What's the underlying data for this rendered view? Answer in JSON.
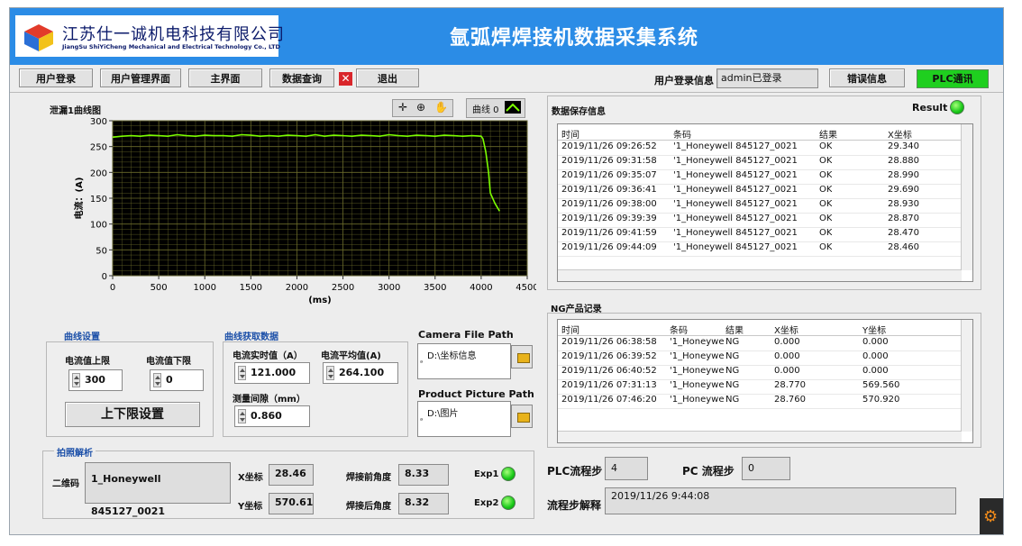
{
  "header": {
    "company_cn": "江苏仕一诚机电科技有限公司",
    "company_en": "JiangSu ShiYiCheng Mechanical and Electrical Technology Co., LTD",
    "system_title": "氩弧焊焊接机数据采集系统"
  },
  "toolbar": {
    "login": "用户登录",
    "user_mgmt": "用户管理界面",
    "main": "主界面",
    "query": "数据查询",
    "exit": "退出",
    "login_info_label": "用户登录信息",
    "login_status": "admin已登录",
    "error_info": "错误信息",
    "plc_comm": "PLC通讯"
  },
  "chart_panel": {
    "title": "泄漏1曲线图",
    "curve_label": "曲线 0"
  },
  "chart_data": {
    "type": "line",
    "title": "",
    "xlabel": "(ms)",
    "ylabel": "电流：(A)",
    "xlim": [
      0,
      4500
    ],
    "ylim": [
      0,
      300
    ],
    "xticks": [
      "0",
      "500",
      "1000",
      "1500",
      "2000",
      "2500",
      "3000",
      "3500",
      "4000",
      "4500"
    ],
    "yticks": [
      "0",
      "50",
      "100",
      "150",
      "200",
      "250",
      "300"
    ],
    "line_color": "#7cfc00",
    "background": "#000000",
    "grid_color": "#6b6b2a",
    "series": [
      {
        "x": [
          0,
          100,
          200,
          300,
          400,
          500,
          600,
          700,
          800,
          900,
          1000,
          1100,
          1200,
          1300,
          1400,
          1500,
          1600,
          1700,
          1800,
          1900,
          2000,
          2100,
          2200,
          2300,
          2400,
          2500,
          2600,
          2700,
          2800,
          2900,
          3000,
          3100,
          3200,
          3300,
          3400,
          3500,
          3600,
          3700,
          3800,
          3900,
          4000,
          4020,
          4050,
          4080,
          4100,
          4150,
          4200
        ],
        "y": [
          268,
          270,
          271,
          270,
          272,
          271,
          270,
          273,
          271,
          270,
          272,
          271,
          271,
          270,
          273,
          272,
          270,
          271,
          270,
          272,
          271,
          270,
          273,
          270,
          272,
          271,
          270,
          272,
          271,
          270,
          273,
          271,
          270,
          272,
          271,
          270,
          272,
          271,
          270,
          271,
          270,
          265,
          240,
          200,
          160,
          140,
          125
        ]
      }
    ]
  },
  "curve_settings": {
    "title": "曲线设置",
    "upper_label": "电流值上限",
    "upper_value": "300",
    "lower_label": "电流值下限",
    "lower_value": "0",
    "apply_button": "上下限设置"
  },
  "curve_data": {
    "title": "曲线获取数据",
    "realtime_label": "电流实时值（A）",
    "realtime_value": "121.000",
    "average_label": "电流平均值(A)",
    "average_value": "264.100",
    "gap_label": "测量间隙（mm）",
    "gap_value": "0.860"
  },
  "camera": {
    "title": "Camera File Path",
    "path": "D:\\坐标信息"
  },
  "product": {
    "title": "Product Picture Path",
    "path": "D:\\图片"
  },
  "photo": {
    "title": "拍照解析",
    "qr_label": "二维码",
    "qr_value": "1_Honeywell 845127_0021",
    "x_label": "X坐标",
    "x_value": "28.46",
    "y_label": "Y坐标",
    "y_value": "570.61",
    "pre_angle_label": "焊接前角度",
    "pre_angle_value": "8.33",
    "post_angle_label": "焊接后角度",
    "post_angle_value": "8.32",
    "exp1": "Exp1",
    "exp2": "Exp2"
  },
  "save_info": {
    "title": "数据保存信息",
    "result_label": "Result",
    "columns": [
      "时间",
      "条码",
      "结果",
      "X坐标"
    ],
    "rows": [
      [
        "2019/11/26 09:26:52",
        "'1_Honeywell 845127_0021",
        "OK",
        "29.340"
      ],
      [
        "2019/11/26 09:31:58",
        "'1_Honeywell 845127_0021",
        "OK",
        "28.880"
      ],
      [
        "2019/11/26 09:35:07",
        "'1_Honeywell 845127_0021",
        "OK",
        "28.990"
      ],
      [
        "2019/11/26 09:36:41",
        "'1_Honeywell 845127_0021",
        "OK",
        "29.690"
      ],
      [
        "2019/11/26 09:38:00",
        "'1_Honeywell 845127_0021",
        "OK",
        "28.930"
      ],
      [
        "2019/11/26 09:39:39",
        "'1_Honeywell 845127_0021",
        "OK",
        "28.870"
      ],
      [
        "2019/11/26 09:41:59",
        "'1_Honeywell 845127_0021",
        "OK",
        "28.470"
      ],
      [
        "2019/11/26 09:44:09",
        "'1_Honeywell 845127_0021",
        "OK",
        "28.460"
      ]
    ]
  },
  "ng_records": {
    "title": "NG产品记录",
    "columns": [
      "时间",
      "条码",
      "结果",
      "X坐标",
      "Y坐标"
    ],
    "rows": [
      [
        "2019/11/26 06:38:58",
        "'1_Honeywe",
        "NG",
        "0.000",
        "0.000"
      ],
      [
        "2019/11/26 06:39:52",
        "'1_Honeywe",
        "NG",
        "0.000",
        "0.000"
      ],
      [
        "2019/11/26 06:40:52",
        "'1_Honeywe",
        "NG",
        "0.000",
        "0.000"
      ],
      [
        "2019/11/26 07:31:13",
        "'1_Honeywe",
        "NG",
        "28.770",
        "569.560"
      ],
      [
        "2019/11/26 07:46:20",
        "'1_Honeywe",
        "NG",
        "28.760",
        "570.920"
      ]
    ]
  },
  "process": {
    "plc_label": "PLC流程步",
    "plc_value": "4",
    "pc_label": "PC 流程步",
    "pc_value": "0",
    "explain_label": "流程步解释",
    "explain_value": "2019/11/26 9:44:08"
  }
}
